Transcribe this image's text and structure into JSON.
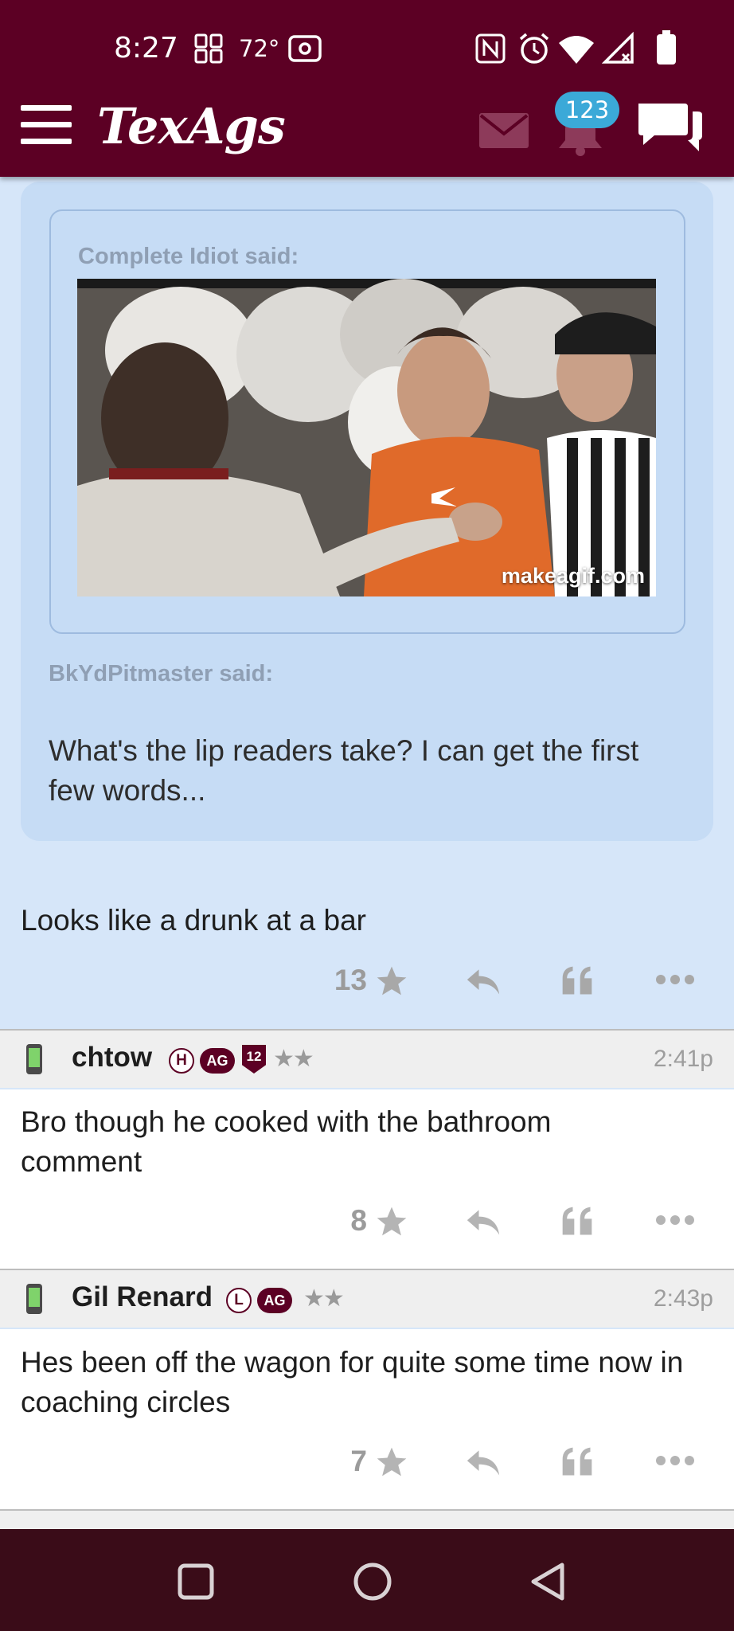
{
  "status_bar": {
    "time": "8:27",
    "temperature": "72°"
  },
  "header": {
    "logo_text": "TexAgs",
    "notification_count": "123"
  },
  "quote": {
    "nested_author": "Complete Idiot said:",
    "gif_watermark": "makeagif.com",
    "outer_author": "BkYdPitmaster said:",
    "outer_text": "What's the lip readers take? I can get the first few words..."
  },
  "posts": [
    {
      "text": "Looks like a drunk at a bar",
      "star_count": "13"
    },
    {
      "username": "chtow",
      "badges": [
        "H",
        "AG",
        "12"
      ],
      "time": "2:41p",
      "text": "Bro though he cooked with the bathroom comment",
      "star_count": "8"
    },
    {
      "username": "Gil Renard",
      "badges": [
        "L",
        "AG"
      ],
      "time": "2:43p",
      "text": "Hes been off the wagon for quite some time now in coaching circles",
      "star_count": "7"
    }
  ],
  "colors": {
    "brand": "#5c0024",
    "page_bg": "#d6e6f9",
    "quote_bg": "#c6dcf5",
    "badge": "#3ba9d8",
    "nav_bar": "#3a0c18"
  },
  "icons": [
    "menu-icon",
    "mail-icon",
    "bell-icon",
    "chat-icon",
    "star-icon",
    "reply-icon",
    "quote-icon",
    "more-icon",
    "phone-icon"
  ]
}
